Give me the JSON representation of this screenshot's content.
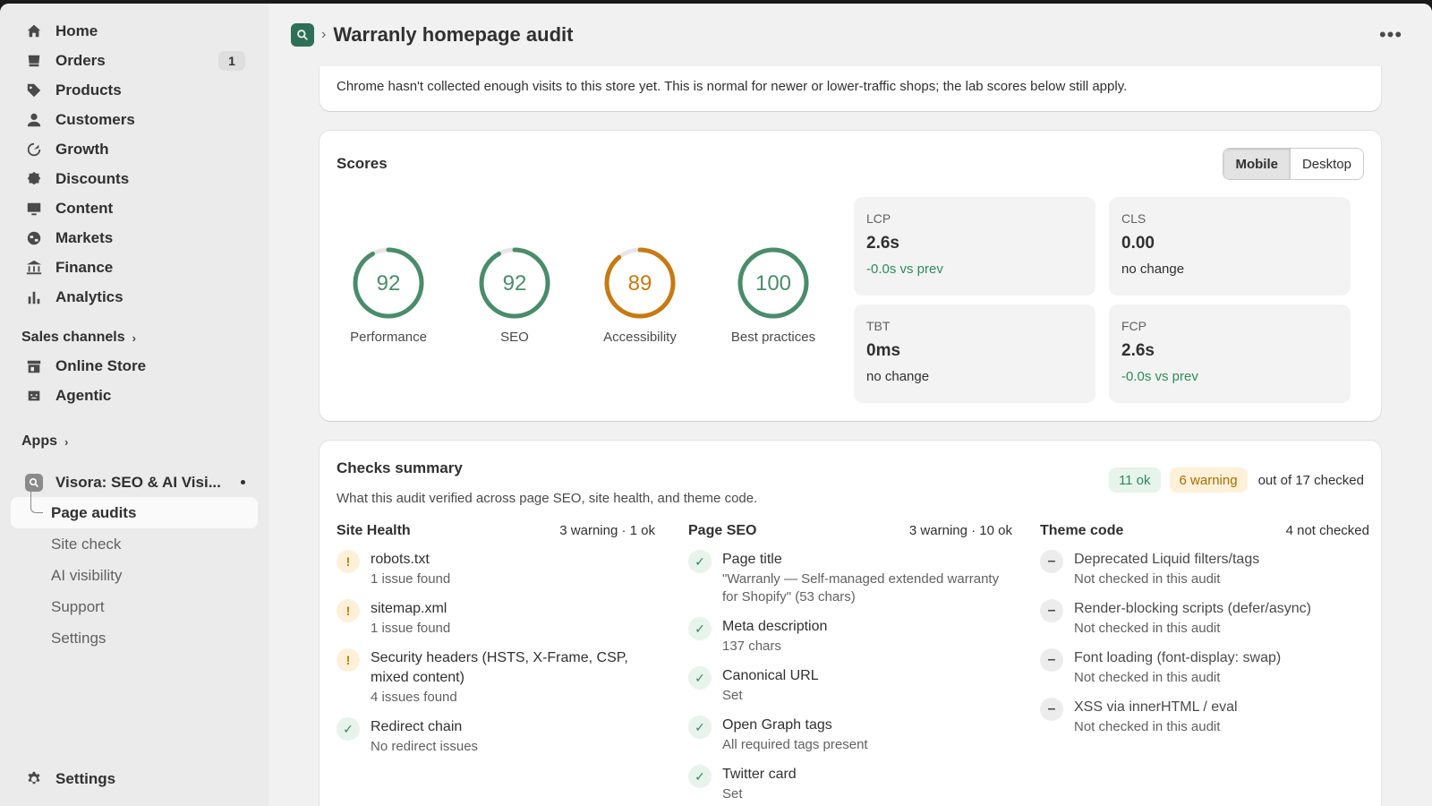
{
  "sidebar": {
    "nav": [
      {
        "label": "Home",
        "icon": "home-icon"
      },
      {
        "label": "Orders",
        "icon": "orders-icon",
        "badge": "1"
      },
      {
        "label": "Products",
        "icon": "tag-icon"
      },
      {
        "label": "Customers",
        "icon": "person-icon"
      },
      {
        "label": "Growth",
        "icon": "growth-icon"
      },
      {
        "label": "Discounts",
        "icon": "discount-icon"
      },
      {
        "label": "Content",
        "icon": "content-icon"
      },
      {
        "label": "Markets",
        "icon": "globe-icon"
      },
      {
        "label": "Finance",
        "icon": "bank-icon"
      },
      {
        "label": "Analytics",
        "icon": "bar-chart-icon"
      }
    ],
    "sales_channels": {
      "label": "Sales channels",
      "items": [
        {
          "label": "Online Store",
          "icon": "store-icon"
        },
        {
          "label": "Agentic",
          "icon": "agentic-icon"
        }
      ]
    },
    "apps": {
      "label": "Apps",
      "app_name": "Visora: SEO & AI Visi...",
      "sub_items": [
        "Page audits",
        "Site check",
        "AI visibility",
        "Support",
        "Settings"
      ]
    },
    "settings_label": "Settings"
  },
  "header": {
    "title": "Warranly homepage audit"
  },
  "notice": {
    "text": "Chrome hasn't collected enough visits to this store yet. This is normal for newer or lower-traffic shops; the lab scores below still apply."
  },
  "scores": {
    "title": "Scores",
    "toggle": {
      "mobile": "Mobile",
      "desktop": "Desktop",
      "selected": "Mobile"
    },
    "gauges": [
      {
        "value": 92,
        "label": "Performance",
        "color": "#4a8c6a"
      },
      {
        "value": 92,
        "label": "SEO",
        "color": "#4a8c6a"
      },
      {
        "value": 89,
        "label": "Accessibility",
        "color": "#c77a12"
      },
      {
        "value": 100,
        "label": "Best practices",
        "color": "#4a8c6a"
      }
    ],
    "metrics": [
      {
        "name": "LCP",
        "value": "2.6s",
        "delta": "-0.0s vs prev",
        "good": true
      },
      {
        "name": "CLS",
        "value": "0.00",
        "delta": "no change",
        "good": false
      },
      {
        "name": "TBT",
        "value": "0ms",
        "delta": "no change",
        "good": false
      },
      {
        "name": "FCP",
        "value": "2.6s",
        "delta": "-0.0s vs prev",
        "good": true
      }
    ]
  },
  "checks": {
    "title": "Checks summary",
    "subtitle": "What this audit verified across page SEO, site health, and theme code.",
    "ok_pill": "11 ok",
    "warn_pill": "6 warning",
    "out_of": "out of 17 checked",
    "columns": [
      {
        "title": "Site Health",
        "count": "3 warning · 1 ok",
        "items": [
          {
            "status": "warn",
            "name": "robots.txt",
            "detail": "1 issue found"
          },
          {
            "status": "warn",
            "name": "sitemap.xml",
            "detail": "1 issue found"
          },
          {
            "status": "warn",
            "name": "Security headers (HSTS, X-Frame, CSP, mixed content)",
            "detail": "4 issues found"
          },
          {
            "status": "ok",
            "name": "Redirect chain",
            "detail": "No redirect issues"
          }
        ]
      },
      {
        "title": "Page SEO",
        "count": "3 warning · 10 ok",
        "items": [
          {
            "status": "ok",
            "name": "Page title",
            "detail": "\"Warranly — Self-managed extended warranty for Shopify\" (53 chars)"
          },
          {
            "status": "ok",
            "name": "Meta description",
            "detail": "137 chars"
          },
          {
            "status": "ok",
            "name": "Canonical URL",
            "detail": "Set"
          },
          {
            "status": "ok",
            "name": "Open Graph tags",
            "detail": "All required tags present"
          },
          {
            "status": "ok",
            "name": "Twitter card",
            "detail": "Set"
          }
        ]
      },
      {
        "title": "Theme code",
        "count": "4 not checked",
        "items": [
          {
            "status": "na",
            "name": "Deprecated Liquid filters/tags",
            "detail": "Not checked in this audit"
          },
          {
            "status": "na",
            "name": "Render-blocking scripts (defer/async)",
            "detail": "Not checked in this audit"
          },
          {
            "status": "na",
            "name": "Font loading (font-display: swap)",
            "detail": "Not checked in this audit"
          },
          {
            "status": "na",
            "name": "XSS via innerHTML / eval",
            "detail": "Not checked in this audit"
          }
        ]
      }
    ]
  }
}
